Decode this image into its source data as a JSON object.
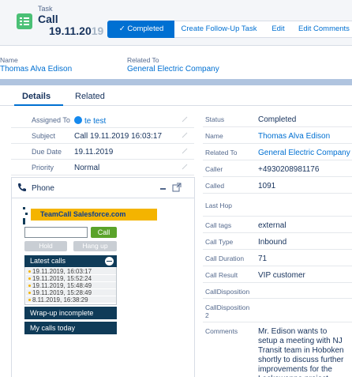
{
  "header": {
    "object_label": "Task",
    "title": "Call",
    "date_visible": "19.11.20",
    "date_faded": "19",
    "buttons": {
      "completed": "Completed",
      "follow_up": "Create Follow-Up Task",
      "edit": "Edit",
      "edit_comments": "Edit Comments"
    }
  },
  "highlights": {
    "name_label": "Name",
    "name_value": "Thomas Alva Edison",
    "related_label": "Related To",
    "related_value": "General Electric Company"
  },
  "tabs": {
    "details": "Details",
    "related": "Related"
  },
  "left_fields": [
    {
      "label": "Assigned To",
      "value": "te test"
    },
    {
      "label": "Subject",
      "value": "Call 19.11.2019 16:03:17"
    },
    {
      "label": "Due Date",
      "value": "19.11.2019"
    },
    {
      "label": "Priority",
      "value": "Normal"
    }
  ],
  "right_fields": [
    {
      "label": "Status",
      "value": "Completed"
    },
    {
      "label": "Name",
      "value": "Thomas Alva Edison"
    },
    {
      "label": "Related To",
      "value": "General Electric Company"
    },
    {
      "label": "Caller",
      "value": "+4930208981176"
    },
    {
      "label": "Called",
      "value": "1091"
    },
    {
      "label": "Last Hop",
      "value": ""
    },
    {
      "label": "Call tags",
      "value": "external"
    },
    {
      "label": "Call Type",
      "value": "Inbound"
    },
    {
      "label": "Call Duration",
      "value": "71"
    },
    {
      "label": "Call Result",
      "value": "VIP customer"
    },
    {
      "label": "CallDisposition",
      "value": ""
    },
    {
      "label": "CallDisposition 2",
      "value": ""
    },
    {
      "label": "Comments",
      "value": "Mr. Edison wants to setup a meeting with NJ Transit team in Hoboken shortly to discuss further improvements for the Lackawanna project"
    }
  ],
  "phone": {
    "title": "Phone",
    "brand": "TeamCall Salesforce.com",
    "call_button": "Call",
    "hold_button": "Hold",
    "hangup_button": "Hang up",
    "latest_calls_label": "Latest calls",
    "latest_calls": [
      "19.11.2019, 16:03:17",
      "19.11.2019, 15:52:24",
      "19.11.2019, 15:48:49",
      "19.11.2019, 15:28:49",
      "8.11.2019, 16:38:29"
    ],
    "wrapup_label": "Wrap-up incomplete",
    "my_calls_label": "My calls today"
  },
  "colors": {
    "brand_blue": "#0070d2",
    "task_green": "#4bc076",
    "teamcall_yellow": "#f4b400",
    "teamcall_navy": "#0f3b58",
    "call_green": "#5aa32a"
  }
}
